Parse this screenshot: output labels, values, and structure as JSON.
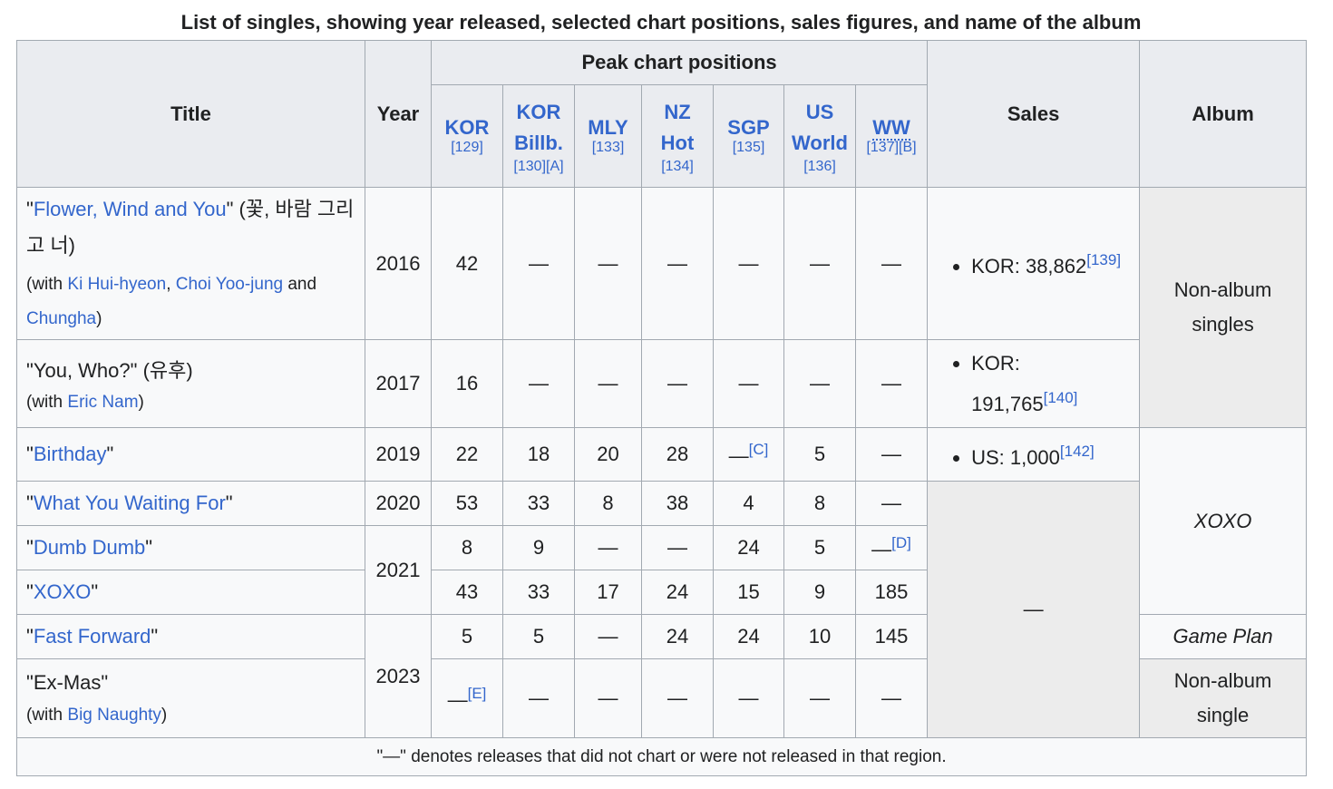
{
  "caption": "List of singles, showing year released, selected chart positions, sales figures, and name of the album",
  "headers": {
    "title": "Title",
    "year": "Year",
    "peak": "Peak chart positions",
    "sales": "Sales",
    "album": "Album",
    "charts": [
      {
        "name": "KOR",
        "ref": "[129]"
      },
      {
        "name_l1": "KOR",
        "name_l2": "Billb.",
        "ref": "[130][A]"
      },
      {
        "name": "MLY",
        "ref": "[133]"
      },
      {
        "name_l1": "NZ",
        "name_l2": "Hot",
        "ref": "[134]"
      },
      {
        "name": "SGP",
        "ref": "[135]"
      },
      {
        "name_l1": "US",
        "name_l2": "World",
        "ref": "[136]"
      },
      {
        "name": "WW",
        "ref": "[137][B]"
      }
    ]
  },
  "rows": [
    {
      "title": "Flower, Wind and You",
      "korean": " (꽃, 바람 그리고 너)",
      "with_prefix": "(with ",
      "feat": [
        "Ki Hui-hyeon",
        "Choi Yoo-jung",
        "Chungha"
      ],
      "sep1": ", ",
      "sep2": " and ",
      "with_suffix": ")",
      "year": "2016",
      "kor": "42",
      "korb": "—",
      "mly": "—",
      "nz": "—",
      "sgp": "—",
      "us": "—",
      "ww": "—",
      "sales": "KOR: 38,862",
      "sales_ref": "[139]"
    },
    {
      "title": "You, Who?",
      "korean": " (유후)",
      "with_prefix": "(with ",
      "feat": [
        "Eric Nam"
      ],
      "with_suffix": ")",
      "year": "2017",
      "kor": "16",
      "korb": "—",
      "mly": "—",
      "nz": "—",
      "sgp": "—",
      "us": "—",
      "ww": "—",
      "sales": "KOR: 191,765",
      "sales_ref": "[140]"
    },
    {
      "title": "Birthday",
      "year": "2019",
      "kor": "22",
      "korb": "18",
      "mly": "20",
      "nz": "28",
      "sgp": "—",
      "sgp_ref": "[C]",
      "us": "5",
      "ww": "—",
      "sales": "US: 1,000",
      "sales_ref": "[142]"
    },
    {
      "title": "What You Waiting For",
      "year": "2020",
      "kor": "53",
      "korb": "33",
      "mly": "8",
      "nz": "38",
      "sgp": "4",
      "us": "8",
      "ww": "—"
    },
    {
      "title": "Dumb Dumb",
      "year": "2021",
      "kor": "8",
      "korb": "9",
      "mly": "—",
      "nz": "—",
      "sgp": "24",
      "us": "5",
      "ww": "—",
      "ww_ref": "[D]"
    },
    {
      "title": "XOXO",
      "kor": "43",
      "korb": "33",
      "mly": "17",
      "nz": "24",
      "sgp": "15",
      "us": "9",
      "ww": "185"
    },
    {
      "title": "Fast Forward",
      "year": "2023",
      "kor": "5",
      "korb": "5",
      "mly": "—",
      "nz": "24",
      "sgp": "24",
      "us": "10",
      "ww": "145"
    },
    {
      "title": "Ex-Mas",
      "with_prefix": "(with ",
      "feat": [
        "Big Naughty"
      ],
      "with_suffix": ")",
      "kor": "—",
      "kor_ref": "[E]",
      "korb": "—",
      "mly": "—",
      "nz": "—",
      "sgp": "—",
      "us": "—",
      "ww": "—"
    }
  ],
  "sales_none": "—",
  "albums": {
    "non_album_singles": "Non-album singles",
    "xoxo": "XOXO",
    "game_plan": "Game Plan",
    "non_album_single": "Non-album single"
  },
  "quote": "\"",
  "note": "\"—\" denotes releases that did not chart or were not released in that region.",
  "colors": {
    "link": "#3366cc",
    "header_bg": "#eaecf0",
    "cell_bg": "#f8f9fa",
    "border": "#a2a9b1"
  }
}
